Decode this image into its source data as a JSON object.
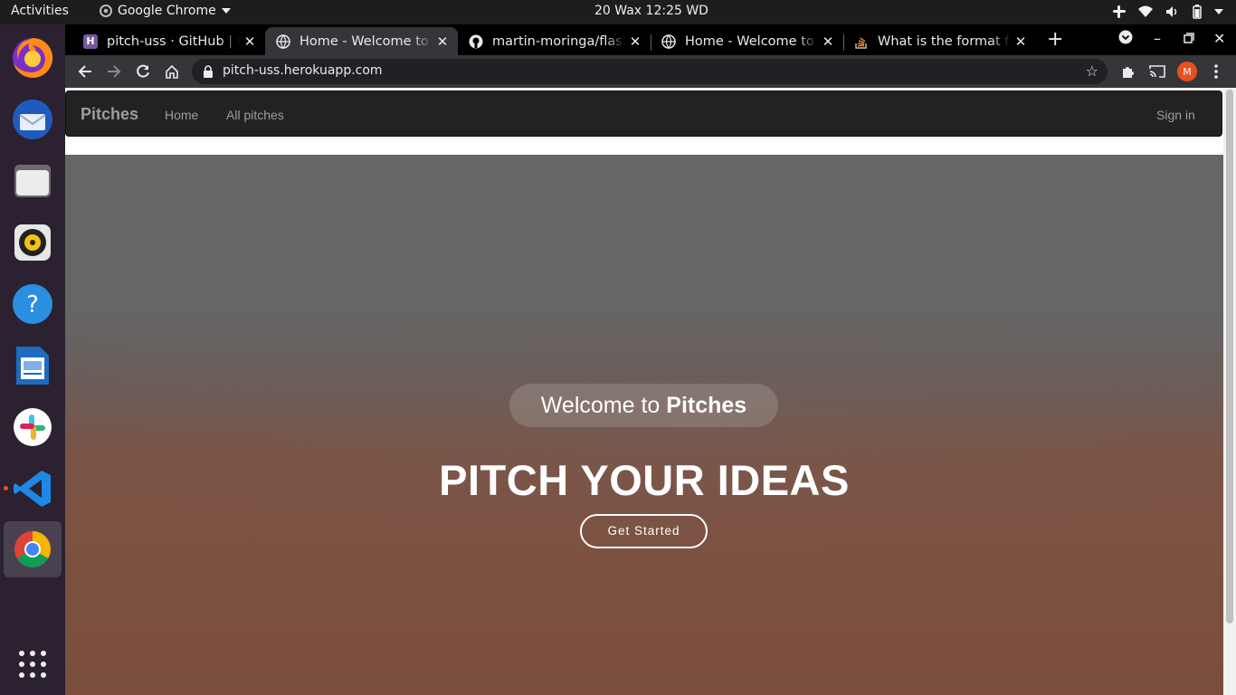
{
  "topbar": {
    "activities": "Activities",
    "app_name": "Google Chrome",
    "clock": "20 Wax  12:25 WD"
  },
  "dock": {
    "items": [
      {
        "name": "firefox-icon"
      },
      {
        "name": "thunderbird-icon"
      },
      {
        "name": "files-icon"
      },
      {
        "name": "rhythmbox-icon"
      },
      {
        "name": "help-icon"
      },
      {
        "name": "writer-icon"
      },
      {
        "name": "slack-icon"
      },
      {
        "name": "vscode-icon"
      },
      {
        "name": "chrome-icon"
      }
    ]
  },
  "tabs": [
    {
      "title": "pitch-uss · GitHub | Heroku",
      "favicon": "H",
      "color": "#79589f"
    },
    {
      "title": "Home - Welcome to The Pitches",
      "favicon": "globe",
      "color": "#5f6368"
    },
    {
      "title": "martin-moringa/flask-pitch",
      "favicon": "github",
      "color": "#000"
    },
    {
      "title": "Home - Welcome to The Pitches",
      "favicon": "globe",
      "color": "#5f6368"
    },
    {
      "title": "What is the format for",
      "favicon": "so",
      "color": "#f48024"
    }
  ],
  "toolbar": {
    "url": "pitch-uss.herokuapp.com",
    "avatar_letter": "M",
    "avatar_color": "#e8501f"
  },
  "site": {
    "brand": "Pitches",
    "nav_home": "Home",
    "nav_all": "All pitches",
    "sign_in": "Sign in",
    "welcome_prefix": "Welcome to ",
    "welcome_brand": "Pitches",
    "headline": "PITCH YOUR IDEAS",
    "cta": "Get Started"
  }
}
